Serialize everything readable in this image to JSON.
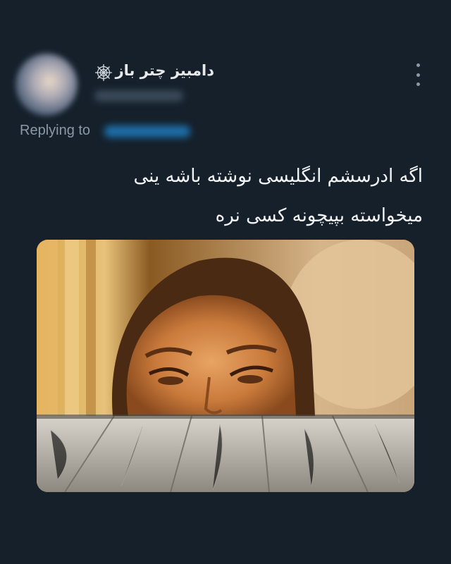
{
  "author": {
    "display_name": "دامبیز چتر باز",
    "badge_icon": "spider-web-icon"
  },
  "reply": {
    "label": "Replying to"
  },
  "tweet": {
    "lines": [
      "اگه ادرسشم انگلیسی نوشته باشه ینی",
      "میخواسته بپیچونه کسی نره"
    ]
  },
  "media": {
    "description_icon": "meme-image"
  },
  "menu": {
    "icon": "more-vertical-icon"
  }
}
